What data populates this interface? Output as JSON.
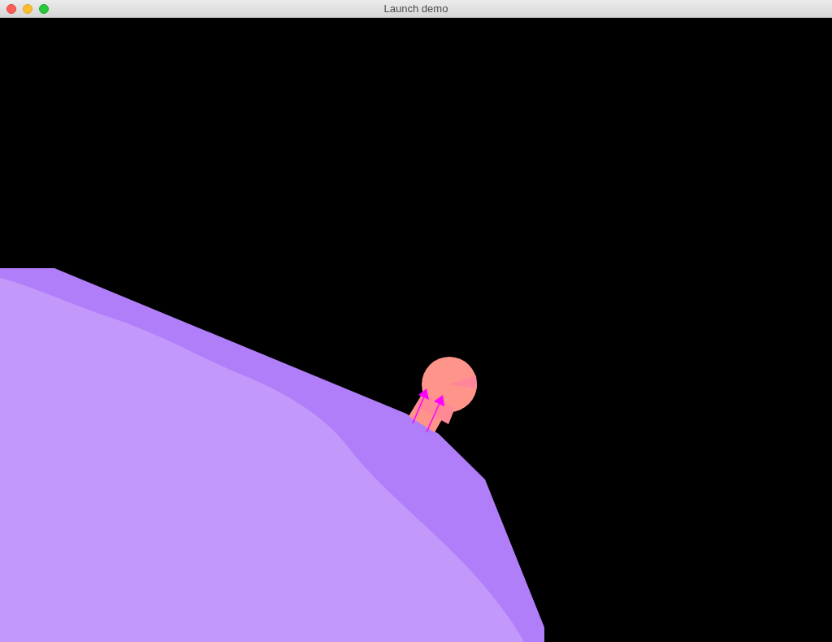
{
  "window": {
    "title": "Launch demo"
  }
}
